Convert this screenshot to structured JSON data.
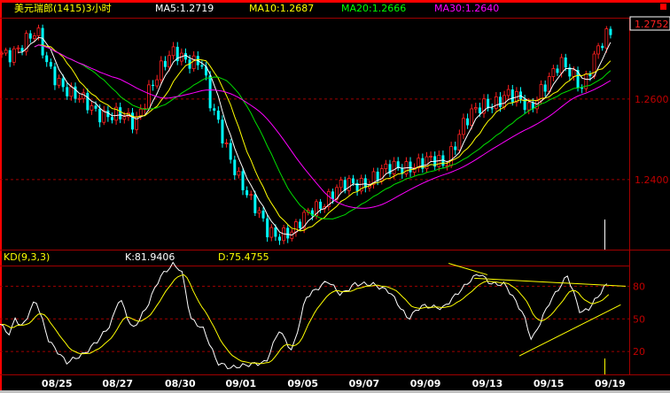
{
  "header": {
    "title": "美元瑞郎(1415)3小时",
    "ma5": "MA5:1.2719",
    "ma10": "MA10:1.2687",
    "ma20": "MA20:1.2666",
    "ma30": "MA30:1.2640"
  },
  "kd_header": {
    "title": "KD(9,3,3)",
    "k": "K:81.9406",
    "d": "D:75.4755"
  },
  "colors": {
    "ma5": "#ffffff",
    "ma10": "#ffff00",
    "ma20": "#00e000",
    "ma30": "#ff00ff",
    "up": "#ff2020",
    "down": "#00ffff",
    "grid": "#a00000",
    "k": "#ffffff",
    "d": "#ffff00"
  },
  "chart_data": [
    {
      "type": "candlestick",
      "title": "美元瑞郎(1415)3小时",
      "ylim": [
        1.2226,
        1.2802
      ],
      "yticks": [
        "1.2600",
        "1.2400"
      ],
      "ytick_values": [
        1.26,
        1.24
      ],
      "last_price": "1.2752",
      "last_price_value": 1.2752,
      "xlim": [
        0,
        100
      ],
      "close_path": [
        [
          0.7,
          1.2714
        ],
        [
          5.7,
          1.2758
        ],
        [
          7.1,
          1.2692
        ],
        [
          11.3,
          1.2604
        ],
        [
          15.6,
          1.2571
        ],
        [
          21.2,
          1.2538
        ],
        [
          23.4,
          1.2626
        ],
        [
          27.6,
          1.2714
        ],
        [
          31.9,
          1.2692
        ],
        [
          33.3,
          1.2582
        ],
        [
          36.8,
          1.2451
        ],
        [
          39.7,
          1.2341
        ],
        [
          42.5,
          1.2275
        ],
        [
          46.7,
          1.2264
        ],
        [
          49.6,
          1.233
        ],
        [
          53.8,
          1.2374
        ],
        [
          59.5,
          1.2407
        ],
        [
          65.2,
          1.244
        ],
        [
          70.8,
          1.244
        ],
        [
          73.7,
          1.2538
        ],
        [
          77.2,
          1.2582
        ],
        [
          80.7,
          1.2615
        ],
        [
          84.3,
          1.2571
        ],
        [
          86.4,
          1.2637
        ],
        [
          89.2,
          1.2681
        ],
        [
          92.8,
          1.2637
        ],
        [
          94.9,
          1.2714
        ],
        [
          97,
          1.2754
        ]
      ],
      "moving_averages": [
        5,
        10,
        20,
        30
      ]
    },
    {
      "type": "line",
      "title": "KD(9,3,3)",
      "ylim": [
        -1,
        99
      ],
      "yticks": [
        "80",
        "50",
        "20"
      ],
      "ytick_values": [
        80,
        50,
        20
      ],
      "k_path": [
        [
          0,
          45
        ],
        [
          1.7,
          35
        ],
        [
          2.3,
          52
        ],
        [
          3.5,
          42
        ],
        [
          5.7,
          68
        ],
        [
          7.8,
          30
        ],
        [
          10.6,
          10
        ],
        [
          13.5,
          18
        ],
        [
          15.6,
          30
        ],
        [
          17.7,
          45
        ],
        [
          19.1,
          70
        ],
        [
          21.2,
          40
        ],
        [
          23.4,
          60
        ],
        [
          25.5,
          88
        ],
        [
          27.6,
          100
        ],
        [
          29,
          95
        ],
        [
          30.5,
          50
        ],
        [
          32.6,
          40
        ],
        [
          34.7,
          10
        ],
        [
          36.8,
          5
        ],
        [
          39.7,
          8
        ],
        [
          42.5,
          10
        ],
        [
          44.6,
          40
        ],
        [
          46.7,
          20
        ],
        [
          48.9,
          70
        ],
        [
          52.4,
          85
        ],
        [
          54.5,
          72
        ],
        [
          56.7,
          82
        ],
        [
          59.5,
          82
        ],
        [
          62.3,
          75
        ],
        [
          65.2,
          50
        ],
        [
          67.3,
          62
        ],
        [
          70.8,
          60
        ],
        [
          75.1,
          85
        ],
        [
          76.5,
          92
        ],
        [
          78.6,
          82
        ],
        [
          80.7,
          82
        ],
        [
          83.6,
          55
        ],
        [
          85,
          30
        ],
        [
          87.8,
          65
        ],
        [
          90.7,
          90
        ],
        [
          92.8,
          55
        ],
        [
          94.2,
          60
        ],
        [
          97,
          82
        ]
      ],
      "trendlines": [
        {
          "from": [
            71.7,
            101
          ],
          "to": [
            77.9,
            90.5
          ]
        },
        {
          "from": [
            75.8,
            87.3
          ],
          "to": [
            100,
            80
          ]
        },
        {
          "from": [
            83,
            16
          ],
          "to": [
            99.2,
            63
          ]
        }
      ]
    }
  ],
  "x_axis": {
    "labels": [
      "08/25",
      "08/27",
      "08/30",
      "09/01",
      "09/05",
      "09/07",
      "09/09",
      "09/13",
      "09/15",
      "09/19"
    ],
    "positions": [
      9.1,
      18.8,
      28.8,
      38.5,
      48.4,
      58.2,
      68,
      77.9,
      87.7,
      97.5
    ]
  }
}
